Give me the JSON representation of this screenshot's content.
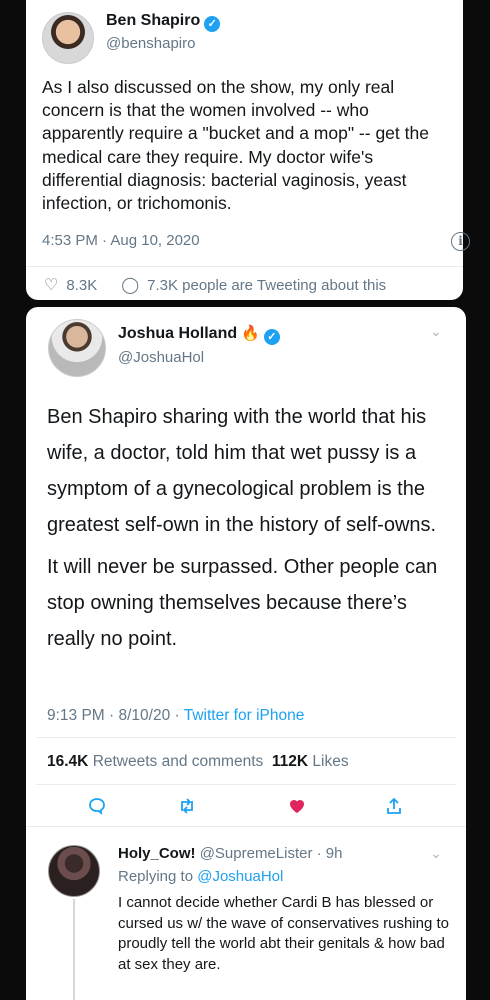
{
  "tweet1": {
    "name": "Ben Shapiro",
    "handle": "@benshapiro",
    "text": "As I also discussed on the show, my only real concern is that the women involved -- who apparently require a \"bucket and a mop\" -- get the medical care they require. My doctor wife's differential diagnosis: bacterial vaginosis, yeast infection, or trichomonis.",
    "timestamp": "4:53 PM · Aug 10, 2020",
    "likes": "8.3K",
    "tweeting_about": "7.3K people are Tweeting about this"
  },
  "tweet2": {
    "name": "Joshua Holland",
    "handle": "@JoshuaHol",
    "paragraphs": [
      "Ben Shapiro sharing with the world that his wife, a doctor, told him that wet pussy is a symptom of a gynecological problem is the greatest self-own in the history of self-owns.",
      "It will never be surpassed. Other people can stop owning themselves because there’s really no point."
    ],
    "time": "9:13 PM · 8/10/20 · ",
    "source": "Twitter for iPhone",
    "retweets_count": "16.4K",
    "retweets_label": "Retweets and comments",
    "likes_count": "112K",
    "likes_label": "Likes"
  },
  "reply": {
    "name": "Holy_Cow!",
    "handle_time": "@SupremeLister · 9h",
    "replying_prefix": "Replying to ",
    "replying_to": "@JoshuaHol",
    "text": "I cannot decide whether Cardi B has blessed or cursed us w/ the wave of conservatives rushing to proudly tell the world abt their genitals & how bad at sex they are."
  },
  "icons": [
    "verified-icon",
    "info-icon",
    "heart-icon",
    "comment-icon",
    "fire-icon",
    "chevron-down-icon",
    "reply-icon",
    "retweet-icon",
    "like-icon",
    "share-icon"
  ],
  "colors": {
    "accent": "#1da1f2",
    "like": "#e0245e",
    "muted": "#657786",
    "background": "#0b0b0b"
  }
}
